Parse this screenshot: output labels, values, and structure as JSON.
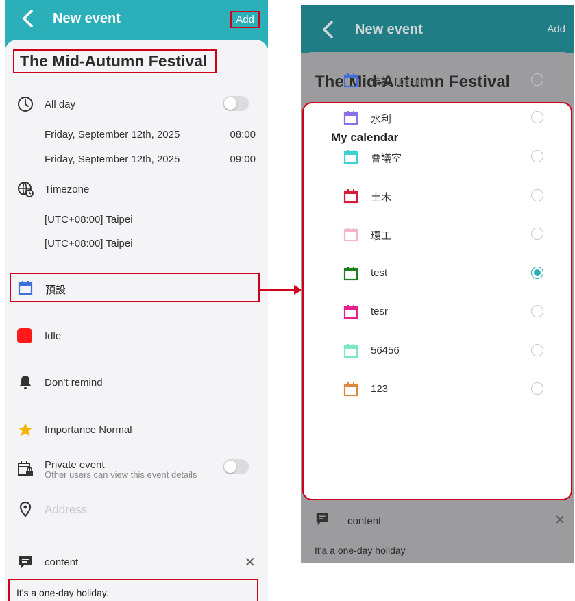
{
  "left": {
    "header": {
      "title": "New event",
      "add_label": "Add"
    },
    "event_title": "The Mid-Autumn Festival",
    "all_day": {
      "label": "All day",
      "enabled": false
    },
    "start": {
      "date": "Friday, September 12th, 2025",
      "time": "08:00"
    },
    "end": {
      "date": "Friday, September 12th, 2025",
      "time": "09:00"
    },
    "timezone": {
      "label": "Timezone",
      "start": "[UTC+08:00] Taipei",
      "end": "[UTC+08:00] Taipei"
    },
    "calendar": {
      "label": "預設",
      "icon": "calendar-icon",
      "color": "#3f6fd8"
    },
    "status": {
      "label": "Idle",
      "color": "#ff1a1a"
    },
    "reminder": {
      "label": "Don't remind",
      "icon": "bell-icon"
    },
    "importance": {
      "label": "Importance Normal",
      "icon": "star-icon",
      "color": "#f5b400"
    },
    "private": {
      "label": "Private event",
      "desc": "Other users can view this event details",
      "enabled": false
    },
    "address": {
      "placeholder": "Address"
    },
    "content": {
      "label": "content",
      "text": "It's a one-day holiday."
    }
  },
  "right": {
    "header": {
      "title": "New event",
      "add_label": "Add"
    },
    "event_title": "The Mid-Autumn Festival",
    "dialog": {
      "heading": "My calendar",
      "calendars": [
        {
          "name": "預設",
          "tag": "[Default]",
          "color": "#3f6fd8",
          "selected": false
        },
        {
          "name": "水利",
          "tag": "",
          "color": "#8a6fe6",
          "selected": false
        },
        {
          "name": "會議室",
          "tag": "",
          "color": "#3fd1d1",
          "selected": false
        },
        {
          "name": "土木",
          "tag": "",
          "color": "#d81b3a",
          "selected": false
        },
        {
          "name": "環工",
          "tag": "",
          "color": "#f5b6c8",
          "selected": false
        },
        {
          "name": "test",
          "tag": "",
          "color": "#1e7d1e",
          "selected": true
        },
        {
          "name": "tesr",
          "tag": "",
          "color": "#e6218f",
          "selected": false
        },
        {
          "name": "56456",
          "tag": "",
          "color": "#7de8c8",
          "selected": false
        },
        {
          "name": "123",
          "tag": "",
          "color": "#d98a3c",
          "selected": false
        }
      ]
    },
    "content": {
      "label": "content",
      "text": "It'a a one-day holiday"
    }
  }
}
